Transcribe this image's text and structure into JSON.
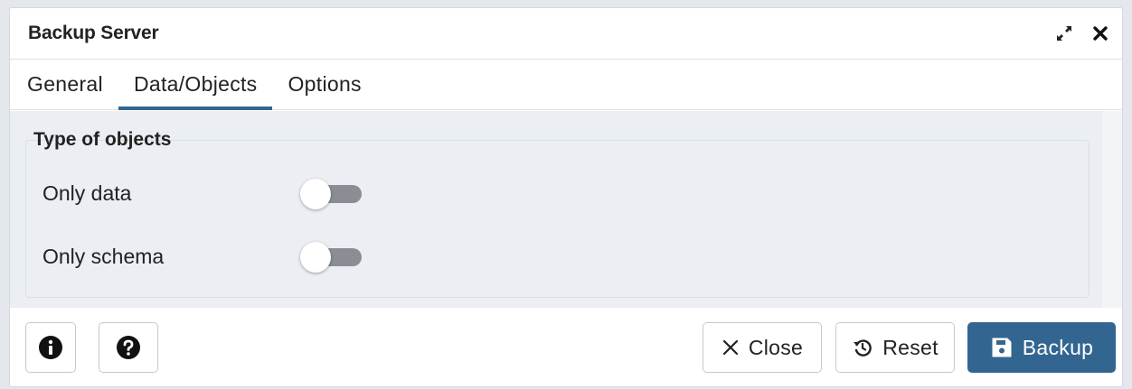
{
  "dialog": {
    "title": "Backup Server"
  },
  "tabs": [
    {
      "label": "General"
    },
    {
      "label": "Data/Objects"
    },
    {
      "label": "Options"
    }
  ],
  "active_tab": "Data/Objects",
  "section": {
    "legend": "Type of objects",
    "fields": [
      {
        "label": "Only data",
        "value": false
      },
      {
        "label": "Only schema",
        "value": false
      }
    ]
  },
  "footer": {
    "close_label": "Close",
    "reset_label": "Reset",
    "backup_label": "Backup"
  },
  "icons": {
    "maximize": "expand-icon",
    "close": "close-icon",
    "info": "info-icon",
    "help": "question-icon",
    "reset": "reset-icon",
    "save": "floppy-disk-icon"
  },
  "colors": {
    "primary": "#326690",
    "content_bg": "#ebeef3",
    "toggle_off": "#8a8d93"
  }
}
